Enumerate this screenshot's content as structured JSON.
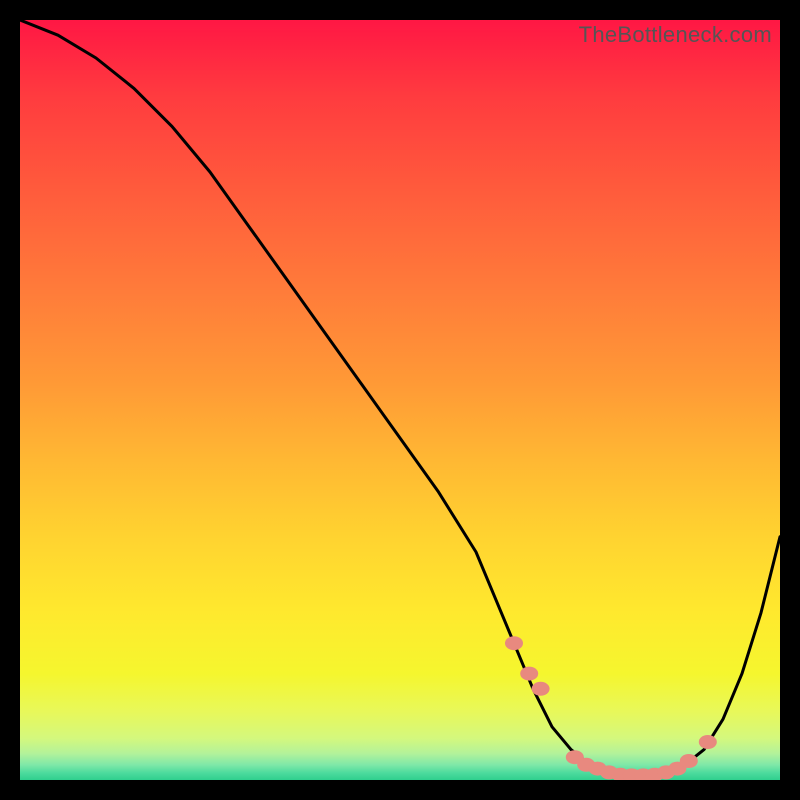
{
  "watermark": "TheBottleneck.com",
  "chart_data": {
    "type": "line",
    "title": "",
    "xlabel": "",
    "ylabel": "",
    "xlim": [
      0,
      100
    ],
    "ylim": [
      0,
      100
    ],
    "series": [
      {
        "name": "bottleneck-curve",
        "x": [
          0,
          5,
          10,
          15,
          20,
          25,
          30,
          35,
          40,
          45,
          50,
          55,
          60,
          62.5,
          65,
          67.5,
          70,
          72.5,
          75,
          77.5,
          80,
          82.5,
          85,
          87.5,
          90,
          92.5,
          95,
          97.5,
          100
        ],
        "values": [
          100,
          98,
          95,
          91,
          86,
          80,
          73,
          66,
          59,
          52,
          45,
          38,
          30,
          24,
          18,
          12,
          7,
          4,
          2,
          1,
          0.5,
          0.5,
          1,
          2,
          4,
          8,
          14,
          22,
          32
        ]
      },
      {
        "name": "highlight-dots",
        "x": [
          65,
          67,
          68.5,
          73,
          74.5,
          76,
          77.5,
          79,
          80.5,
          82,
          83.5,
          85,
          86.5,
          88,
          90.5
        ],
        "values": [
          18,
          14,
          12,
          3,
          2,
          1.5,
          1,
          0.7,
          0.6,
          0.6,
          0.7,
          1,
          1.5,
          2.5,
          5
        ]
      }
    ],
    "gradient_stops": [
      {
        "offset": 0.0,
        "color": "#ff1744"
      },
      {
        "offset": 0.1,
        "color": "#ff3b3f"
      },
      {
        "offset": 0.22,
        "color": "#ff5a3c"
      },
      {
        "offset": 0.35,
        "color": "#ff7a3a"
      },
      {
        "offset": 0.48,
        "color": "#ff9a36"
      },
      {
        "offset": 0.58,
        "color": "#ffb833"
      },
      {
        "offset": 0.68,
        "color": "#ffd330"
      },
      {
        "offset": 0.78,
        "color": "#ffe92e"
      },
      {
        "offset": 0.86,
        "color": "#f5f62e"
      },
      {
        "offset": 0.91,
        "color": "#e8f85a"
      },
      {
        "offset": 0.945,
        "color": "#d4f87d"
      },
      {
        "offset": 0.965,
        "color": "#b3f29a"
      },
      {
        "offset": 0.98,
        "color": "#7fe8a8"
      },
      {
        "offset": 0.99,
        "color": "#4fdc9e"
      },
      {
        "offset": 1.0,
        "color": "#2fcf8e"
      }
    ],
    "dot_color": "#e8897f",
    "curve_color": "#000000"
  }
}
